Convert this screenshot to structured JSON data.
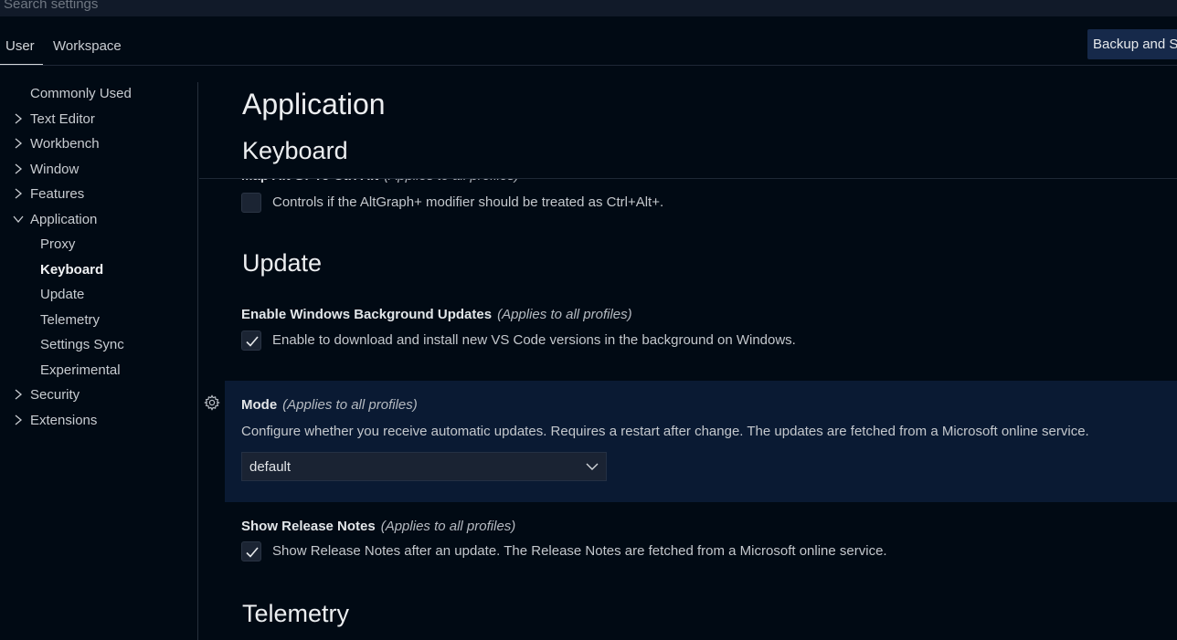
{
  "search": {
    "placeholder": "Search settings"
  },
  "tabs": [
    {
      "label": "User",
      "active": true
    },
    {
      "label": "Workspace",
      "active": false
    }
  ],
  "backup_button": {
    "label": "Backup and Sync Settings"
  },
  "toc": [
    {
      "label": "Commonly Used",
      "level": 0,
      "chevron": "none"
    },
    {
      "label": "Text Editor",
      "level": 0,
      "chevron": "chevron-right-icon"
    },
    {
      "label": "Workbench",
      "level": 0,
      "chevron": "chevron-right-icon"
    },
    {
      "label": "Window",
      "level": 0,
      "chevron": "chevron-right-icon"
    },
    {
      "label": "Features",
      "level": 0,
      "chevron": "chevron-right-icon"
    },
    {
      "label": "Application",
      "level": 0,
      "chevron": "chevron-down-icon"
    },
    {
      "label": "Proxy",
      "level": 1
    },
    {
      "label": "Keyboard",
      "level": 1,
      "active": true
    },
    {
      "label": "Update",
      "level": 1
    },
    {
      "label": "Telemetry",
      "level": 1
    },
    {
      "label": "Settings Sync",
      "level": 1
    },
    {
      "label": "Experimental",
      "level": 1
    },
    {
      "label": "Security",
      "level": 0,
      "chevron": "chevron-right-icon"
    },
    {
      "label": "Extensions",
      "level": 0,
      "chevron": "chevron-right-icon"
    }
  ],
  "content": {
    "category_title": "Application",
    "sticky_section": "Keyboard",
    "altgr": {
      "title": "Map Alt Gr To Ctrl Alt",
      "scope": "(Applies to all profiles)",
      "description": "Controls if the AltGraph+ modifier should be treated as Ctrl+Alt+.",
      "checked": false
    },
    "update_section": "Update",
    "background_updates": {
      "title": "Enable Windows Background Updates",
      "scope": "(Applies to all profiles)",
      "description": "Enable to download and install new VS Code versions in the background on Windows.",
      "checked": true
    },
    "mode": {
      "title": "Mode",
      "scope": "(Applies to all profiles)",
      "description": "Configure whether you receive automatic updates. Requires a restart after change. The updates are fetched from a Microsoft online service.",
      "value": "default"
    },
    "release_notes": {
      "title": "Show Release Notes",
      "scope": "(Applies to all profiles)",
      "description": "Show Release Notes after an update. The Release Notes are fetched from a Microsoft online service.",
      "checked": true
    },
    "telemetry_section": "Telemetry"
  },
  "colors": {
    "background": "#010a14",
    "focused_row": "#0a1a33",
    "button": "#16294a"
  }
}
